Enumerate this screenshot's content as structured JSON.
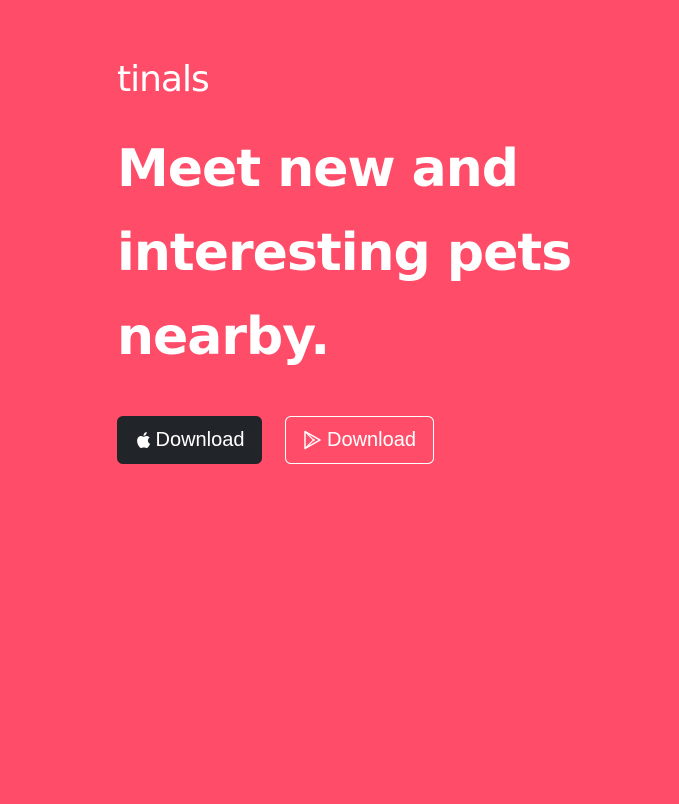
{
  "brand": {
    "name": "tinals"
  },
  "hero": {
    "headline_lines": [
      "Meet new and",
      "interesting pets",
      "nearby."
    ]
  },
  "buttons": {
    "apple": {
      "icon": "apple-icon",
      "label": "Download"
    },
    "play": {
      "icon": "google-play-icon",
      "label": "Download"
    }
  },
  "colors": {
    "background": "#ff4c68",
    "text": "#ffffff",
    "apple_button": "#212529",
    "play_button_border": "#ffffff"
  }
}
